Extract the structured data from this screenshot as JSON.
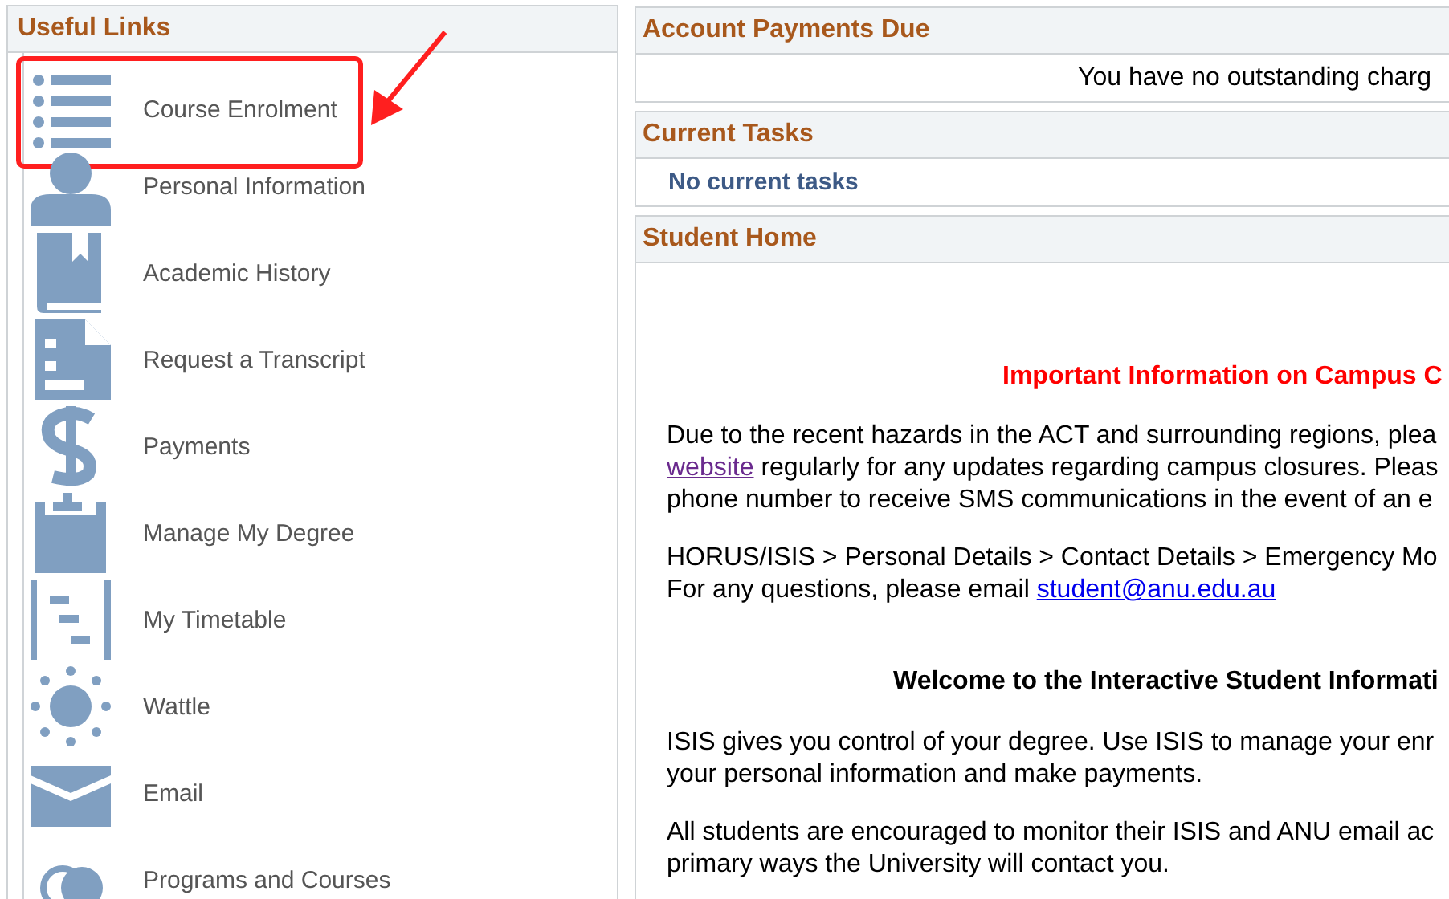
{
  "sidebar": {
    "title": "Useful Links",
    "items": [
      {
        "label": "Course Enrolment",
        "highlighted": true
      },
      {
        "label": "Personal Information",
        "highlighted": false
      },
      {
        "label": "Academic History",
        "highlighted": false
      },
      {
        "label": "Request a Transcript",
        "highlighted": false
      },
      {
        "label": "Payments",
        "highlighted": false
      },
      {
        "label": "Manage My Degree",
        "highlighted": false
      },
      {
        "label": "My Timetable",
        "highlighted": false
      },
      {
        "label": "Wattle",
        "highlighted": false
      },
      {
        "label": "Email",
        "highlighted": false
      },
      {
        "label": "Programs and Courses",
        "highlighted": false
      }
    ]
  },
  "portlets": [
    {
      "title": "Account Payments Due",
      "kind": "notice",
      "text": "You have no outstanding charg"
    },
    {
      "title": "Current Tasks",
      "kind": "tasks",
      "text": "No current tasks"
    },
    {
      "title": "Student Home",
      "kind": "content",
      "blocks": [
        {
          "kind": "alert",
          "lines": [
            [
              {
                "text": "Important Information on Campus C"
              }
            ]
          ]
        },
        {
          "kind": "paragraph",
          "lines": [
            [
              {
                "text": "Due to the recent hazards in the ACT and surrounding regions, plea"
              }
            ],
            [
              {
                "text": "website",
                "link": true,
                "visited": true
              },
              {
                "text": " regularly for any updates regarding campus closures. Pleas"
              }
            ],
            [
              {
                "text": "phone number to receive SMS communications in the event of an e"
              }
            ]
          ]
        },
        {
          "kind": "paragraph",
          "lines": [
            [
              {
                "text": "HORUS/ISIS > Personal Details > Contact Details > Emergency Mo"
              }
            ],
            [
              {
                "text": "For any questions, please email "
              },
              {
                "text": "student@anu.edu.au",
                "link": true,
                "visited": false
              }
            ]
          ]
        },
        {
          "kind": "heading",
          "lines": [
            [
              {
                "text": "Welcome to the Interactive Student Informati"
              }
            ]
          ]
        },
        {
          "kind": "paragraph",
          "lines": [
            [
              {
                "text": "ISIS gives you control of your degree. Use ISIS to manage your enr"
              }
            ],
            [
              {
                "text": "your personal information and make payments."
              }
            ]
          ]
        },
        {
          "kind": "paragraph",
          "lines": [
            [
              {
                "text": "All students are encouraged to monitor their ISIS and ANU email ac"
              }
            ],
            [
              {
                "text": "primary ways the University will contact you."
              }
            ]
          ]
        }
      ]
    }
  ]
}
